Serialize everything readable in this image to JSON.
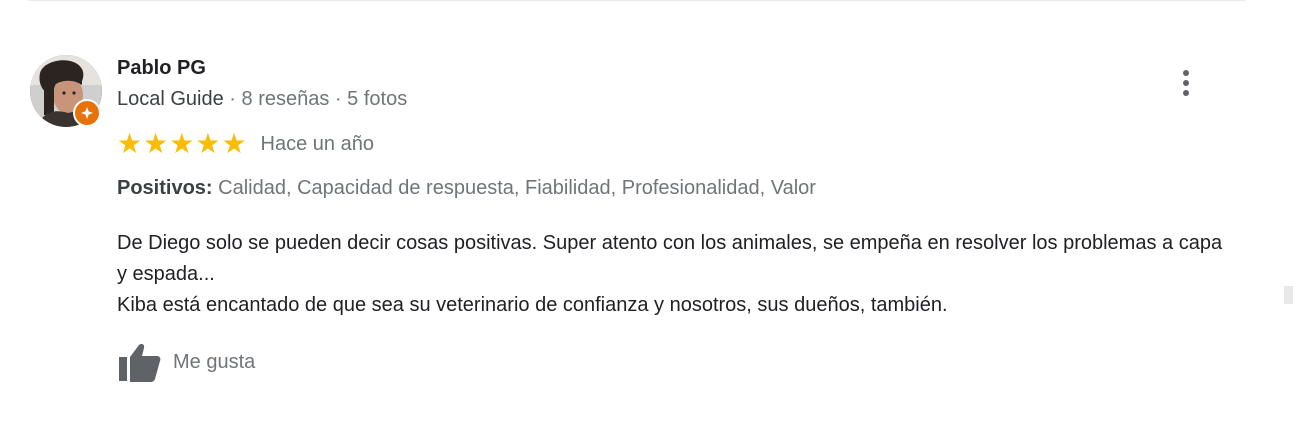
{
  "review": {
    "reviewer_name": "Pablo PG",
    "local_guide_label": "Local Guide",
    "meta_separator": " · ",
    "reviews_count": "8 reseñas",
    "photos_count": "5 fotos",
    "rating": 5,
    "rating_max": 5,
    "date": "Hace un año",
    "positives_label": "Positivos:",
    "positives_values": "Calidad, Capacidad de respuesta, Fiabilidad, Profesionalidad, Valor",
    "text_lines": [
      "De Diego solo se pueden decir cosas positivas. Super atento con los animales, se empeña en resolver los problemas a capa y espada...",
      "Kiba está encantado de que sea su veterinario de confianza y nosotros, sus dueños, también."
    ],
    "like_label": "Me gusta"
  },
  "icons": {
    "avatar": "reviewer-photo",
    "badge": "local-guide-badge-icon",
    "more": "more-vert-icon",
    "star": "star-icon",
    "like": "thumb-up-icon"
  },
  "colors": {
    "star": "#fbbc04",
    "badge": "#e8710a",
    "muted_text": "#70757a",
    "primary_text": "#202124",
    "icon_gray": "#5f6368"
  }
}
